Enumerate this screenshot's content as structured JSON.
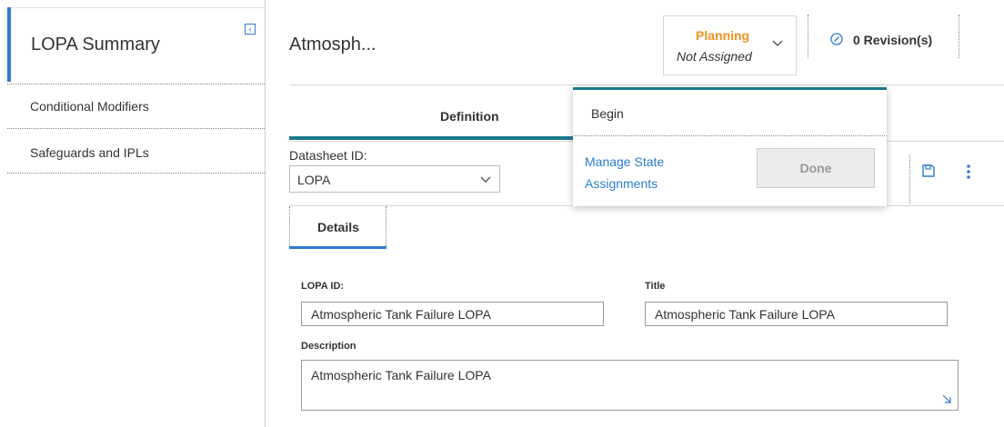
{
  "sidebar": {
    "title": "LOPA Summary",
    "collapse_glyph": "‹",
    "items": [
      {
        "label": "Conditional Modifiers"
      },
      {
        "label": "Safeguards and IPLs"
      }
    ]
  },
  "header": {
    "title": "Atmosph...",
    "state": {
      "name": "Planning",
      "assignment": "Not Assigned"
    },
    "revisions_label": "0 Revision(s)"
  },
  "tabs": [
    {
      "label": "Definition",
      "active": true
    }
  ],
  "datasheet": {
    "label": "Datasheet ID:",
    "value": "LOPA"
  },
  "subtabs": [
    {
      "label": "Details",
      "active": true
    }
  ],
  "form": {
    "lopa_id": {
      "label": "LOPA ID:",
      "value": "Atmospheric Tank Failure LOPA"
    },
    "title": {
      "label": "Title",
      "value": "Atmospheric Tank Failure LOPA"
    },
    "description": {
      "label": "Description",
      "value": "Atmospheric Tank Failure LOPA"
    }
  },
  "state_menu": {
    "transition": "Begin",
    "manage_link": "Manage State Assignments",
    "done_label": "Done"
  },
  "colors": {
    "accent_blue": "#2e7bcf",
    "teal": "#1c7a8c",
    "state_orange": "#f0911f"
  },
  "icons": [
    "collapse-icon",
    "chevron-down-icon",
    "revision-icon",
    "save-icon",
    "more-vertical-icon",
    "resize-icon"
  ]
}
